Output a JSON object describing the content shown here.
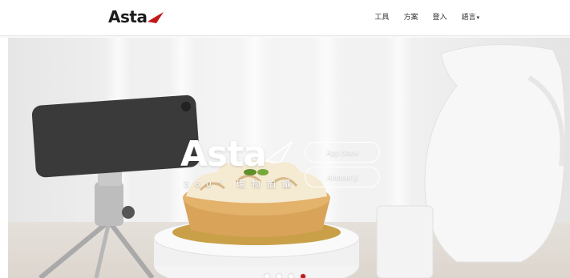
{
  "header": {
    "logo_text": "Asta",
    "nav": {
      "tools": "工具",
      "solutions": "方案",
      "login": "登入",
      "language": "語言",
      "language_caret": "▾"
    }
  },
  "hero": {
    "brand_title": "Asta",
    "tagline": "360° 環物拍攝",
    "buttons": {
      "app_store": "App Store",
      "android": "Android β"
    },
    "slides_total": 4,
    "active_slide": 4
  },
  "colors": {
    "accent": "#c01818",
    "logo_dark": "#1c1c1c"
  }
}
